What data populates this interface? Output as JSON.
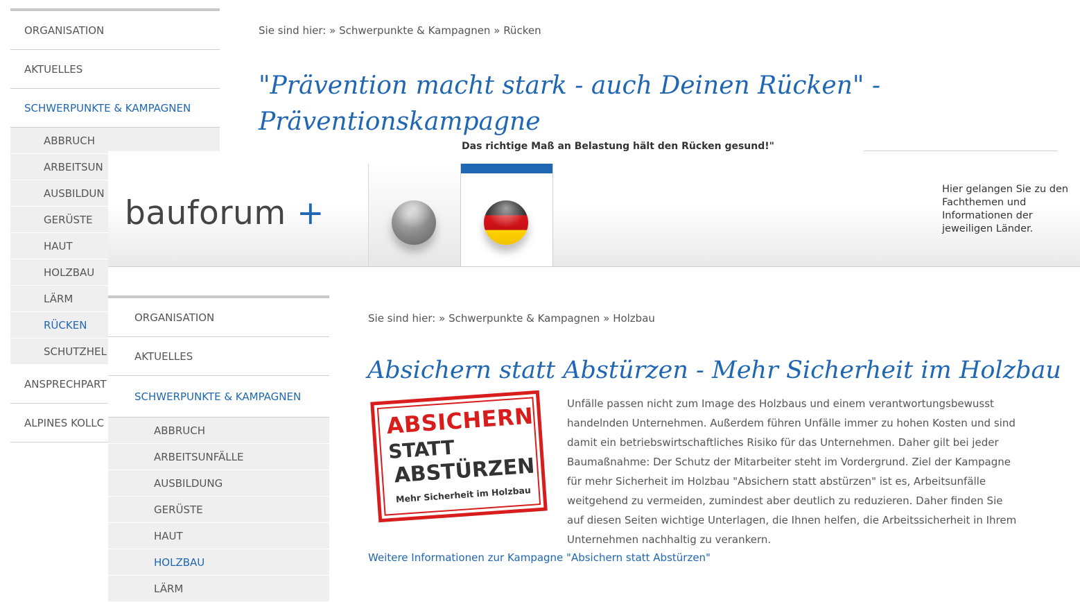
{
  "back_page": {
    "nav": {
      "items_top": [
        "ORGANISATION",
        "AKTUELLES",
        "SCHWERPUNKTE & KAMPAGNEN"
      ],
      "sub_items": [
        "ABBRUCH",
        "ARBEITSUN",
        "AUSBILDUN",
        "GERÜSTE",
        "HAUT",
        "HOLZBAU",
        "LÄRM",
        "RÜCKEN",
        "SCHUTZHEL"
      ],
      "items_bottom": [
        "ANSPRECHPART",
        "ALPINES KOLLC"
      ]
    },
    "breadcrumb": {
      "prefix": "Sie sind hier:",
      "sep": "»",
      "level1": "Schwerpunkte & Kampagnen",
      "level2": "Rücken"
    },
    "title_line1": "\"Prävention macht stark - auch Deinen Rücken\" -",
    "title_line2": "Präventionskampagne",
    "cut_text": "Das richtige Maß an Belastung hält den Rücken gesund!\""
  },
  "header": {
    "logo_text": "bauforum",
    "logo_plus": "+",
    "hint_text": "Hier gelangen Sie zu den Fachthemen und Informationen der jeweiligen Länder."
  },
  "front_page": {
    "nav": {
      "items_top": [
        "ORGANISATION",
        "AKTUELLES",
        "SCHWERPUNKTE & KAMPAGNEN"
      ],
      "sub_items": [
        "ABBRUCH",
        "ARBEITSUNFÄLLE",
        "AUSBILDUNG",
        "GERÜSTE",
        "HAUT",
        "HOLZBAU",
        "LÄRM"
      ]
    },
    "breadcrumb": {
      "prefix": "Sie sind hier:",
      "sep": "»",
      "level1": "Schwerpunkte & Kampagnen",
      "level2": "Holzbau"
    },
    "title": "Absichern statt Abstürzen - Mehr Sicherheit im Holzbau",
    "stamp": {
      "line1": "ABSICHERN",
      "line2": "STATT",
      "line3": "ABSTÜRZEN",
      "line4": "Mehr Sicherheit im Holzbau"
    },
    "body": "Unfälle passen nicht zum Image des Holzbaus und einem verantwortungsbewusst handelnden Unternehmen. Außerdem führen Unfälle immer zu hohen Kosten und sind damit ein betriebswirtschaftliches Risiko für das Unternehmen. Daher gilt bei jeder Baumaßnahme: Der Schutz der Mitarbeiter steht im Vordergrund. Ziel der Kampagne für mehr Sicherheit im Holzbau \"Absichern statt abstürzen\" ist es, Arbeitsunfälle weitgehend zu vermeiden, zumindest aber deutlich zu reduzieren. Daher finden Sie auf diesen Seiten wichtige Unterlagen, die Ihnen helfen, die Arbeitssicherheit in Ihrem Unternehmen nachhaltig zu verankern.",
    "more_link": "Weitere Informationen zur Kampagne \"Absichern statt Abstürzen\""
  },
  "colors": {
    "accent": "#1f66b3",
    "stamp_red": "#d81d1d"
  }
}
